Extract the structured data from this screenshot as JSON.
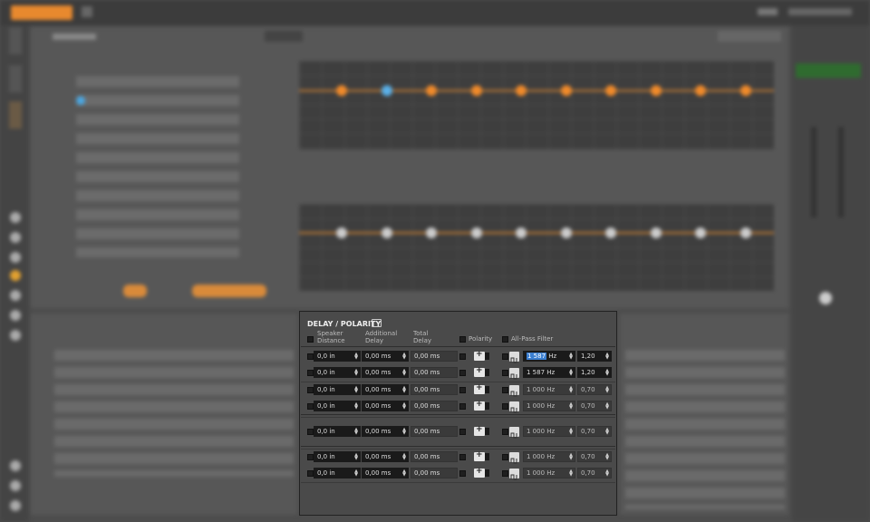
{
  "dialog": {
    "title": "DELAY / POLARITY",
    "icon": "graph-icon",
    "headers": {
      "speaker": "Speaker\nDistance",
      "additional": "Additional\nDelay",
      "total": "Total\nDelay",
      "polarity": "Polarity",
      "allpass": "All-Pass Filter"
    },
    "rows": [
      {
        "dist": "0,0 in",
        "delay": "0,00 ms",
        "total": "0,00 ms",
        "freq": "1 587",
        "unit": " Hz",
        "q": "1,20",
        "active": true,
        "selected": true
      },
      {
        "dist": "0,0 in",
        "delay": "0,00 ms",
        "total": "0,00 ms",
        "freq": "1 587 Hz",
        "q": "1,20",
        "active": true,
        "selected": false
      },
      {
        "dist": "0,0 in",
        "delay": "0,00 ms",
        "total": "0,00 ms",
        "freq": "1 000 Hz",
        "q": "0,70",
        "active": false,
        "selected": false
      },
      {
        "dist": "0,0 in",
        "delay": "0,00 ms",
        "total": "0,00 ms",
        "freq": "1 000 Hz",
        "q": "0,70",
        "active": false,
        "selected": false
      },
      {
        "dist": "0,0 in",
        "delay": "0,00 ms",
        "total": "0,00 ms",
        "freq": "1 000 Hz",
        "q": "0,70",
        "active": false,
        "selected": false
      },
      {
        "dist": "0,0 in",
        "delay": "0,00 ms",
        "total": "0,00 ms",
        "freq": "1 000 Hz",
        "q": "0,70",
        "active": false,
        "selected": false
      },
      {
        "dist": "0,0 in",
        "delay": "0,00 ms",
        "total": "0,00 ms",
        "freq": "1 000 Hz",
        "q": "0,70",
        "active": false,
        "selected": false
      }
    ]
  },
  "colors": {
    "accent": "#f08a2a",
    "selection": "#3b7fd1",
    "dialog_bg": "#4a4a4a"
  }
}
